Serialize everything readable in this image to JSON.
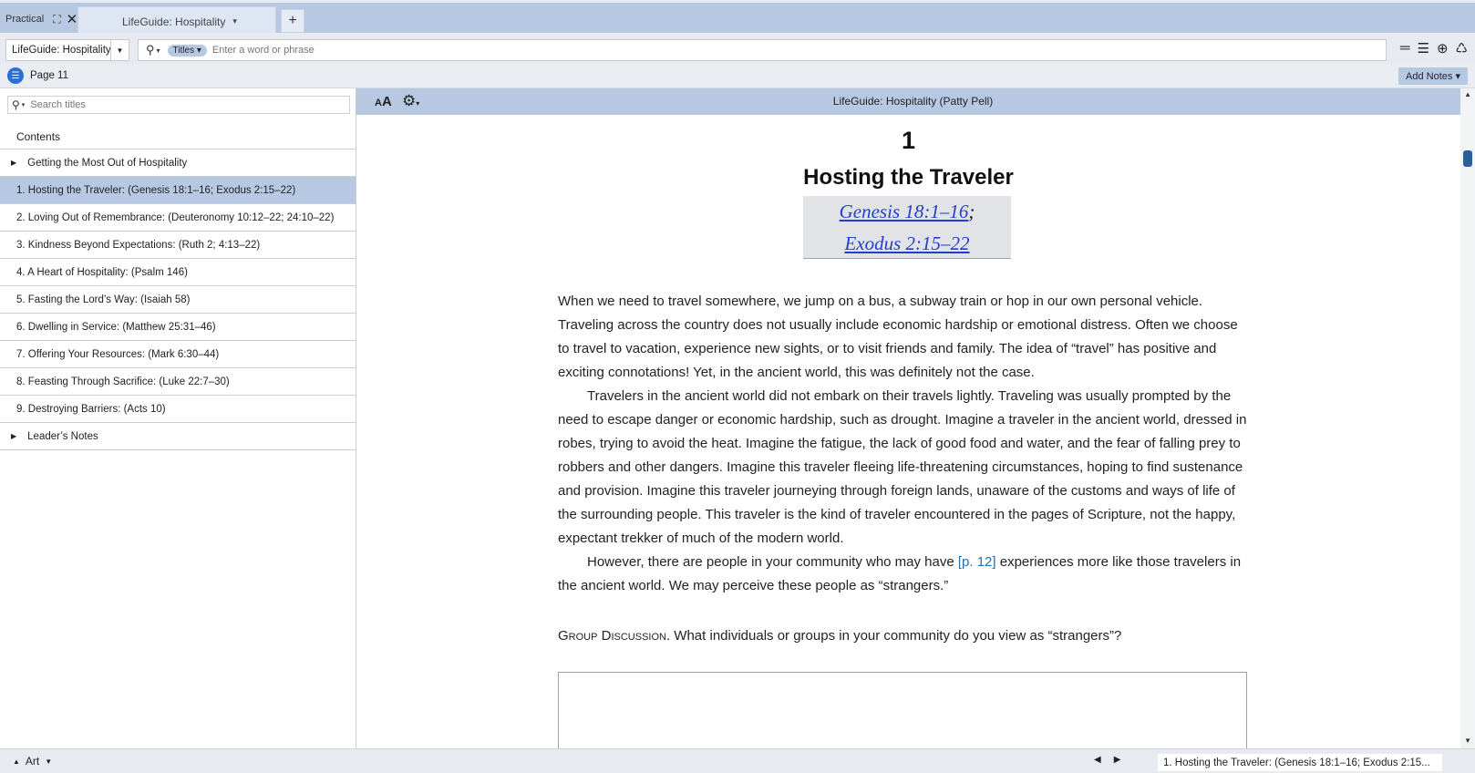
{
  "tabs": {
    "inactive_label": "Practical",
    "active_label": "LifeGuide: Hospitality",
    "add_label": "+"
  },
  "toolbar": {
    "book_name": "LifeGuide: Hospitality",
    "search_scope": "Titles",
    "search_placeholder": "Enter a word or phrase"
  },
  "page_row": {
    "page_label": "Page 11",
    "add_notes_label": "Add Notes"
  },
  "sidebar": {
    "search_placeholder": "Search titles",
    "contents_label": "Contents",
    "items": [
      {
        "label": "Getting the Most Out of Hospitality",
        "expandable": true,
        "selected": false
      },
      {
        "label": "1. Hosting the Traveler:  (Genesis 18:1–16; Exodus 2:15–22)",
        "expandable": false,
        "selected": true
      },
      {
        "label": "2. Loving Out of Remembrance:  (Deuteronomy 10:12–22; 24:10–22)",
        "expandable": false,
        "selected": false
      },
      {
        "label": "3. Kindness Beyond Expectations:  (Ruth 2; 4:13–22)",
        "expandable": false,
        "selected": false
      },
      {
        "label": "4. A Heart of Hospitality:  (Psalm 146)",
        "expandable": false,
        "selected": false
      },
      {
        "label": "5. Fasting the Lord’s Way:  (Isaiah 58)",
        "expandable": false,
        "selected": false
      },
      {
        "label": "6. Dwelling in Service:  (Matthew 25:31–46)",
        "expandable": false,
        "selected": false
      },
      {
        "label": "7. Offering Your Resources:  (Mark 6:30–44)",
        "expandable": false,
        "selected": false
      },
      {
        "label": "8. Feasting Through Sacrifice:  (Luke 22:7–30)",
        "expandable": false,
        "selected": false
      },
      {
        "label": "9. Destroying Barriers:  (Acts 10)",
        "expandable": false,
        "selected": false
      },
      {
        "label": "Leader’s Notes",
        "expandable": true,
        "selected": false
      }
    ]
  },
  "reader": {
    "header_title": "LifeGuide: Hospitality (Patty Pell)",
    "chapter_number": "1",
    "chapter_title": "Hosting the Traveler",
    "ref1": "Genesis 18:1–16",
    "ref_separator": ";",
    "ref2": "Exodus 2:15–22",
    "para1": "When we need to travel somewhere, we jump on a bus, a subway train or hop in our own personal vehicle. Traveling across the country does not usually include economic hardship or emotional distress. Often we choose to travel to vacation, experience new sights, or to visit friends and family. The idea of “travel” has positive and exciting connotations! Yet, in the ancient world, this was definitely not the case.",
    "para2": "Travelers in the ancient world did not embark on their travels lightly. Traveling was usually prompted by the need to escape danger or economic hardship, such as drought. Imagine a traveler in the ancient world, dressed in robes, trying to avoid the heat. Imagine the fatigue, the lack of good food and water, and the fear of falling prey to robbers and other dangers. Imagine this traveler fleeing life-threatening circumstances, hoping to find sustenance and provision. Imagine this traveler journeying through foreign lands, unaware of the customs and ways of life of the surrounding people. This traveler is the kind of traveler encountered in the pages of Scripture, not the happy, expectant trekker of much of the modern world.",
    "para3_before": "However, there are people in your community who may have ",
    "page_link": "[p. 12]",
    "para3_after": " experiences more like those travelers in the ancient world. We may perceive these people as “strangers.”",
    "discussion_label": "Group Discussion.",
    "discussion_question": " What individuals or groups in your community do you view as “strangers”?"
  },
  "statusbar": {
    "art_label": "Art",
    "location": "1. Hosting the Traveler:  (Genesis 18:1–16; Exodus 2:15..."
  },
  "colors": {
    "accent": "#b7c9e2",
    "link": "#1f3fcc",
    "page_link": "#2b6ea6",
    "toc_button": "#2a6fd6"
  }
}
